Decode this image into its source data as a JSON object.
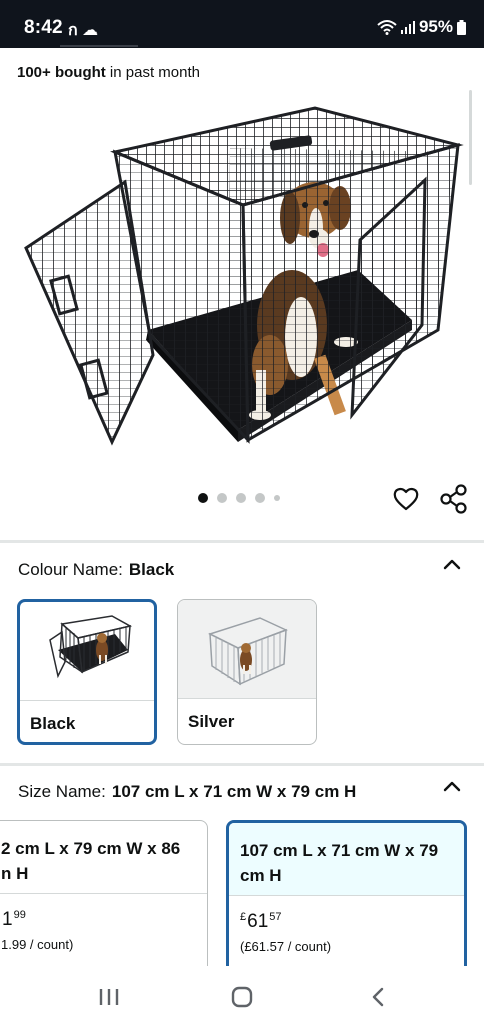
{
  "status_bar": {
    "time": "8:42",
    "app_icons": "ก ☁",
    "battery": "95%"
  },
  "product": {
    "bought_bold": "100+ bought",
    "bought_rest": " in past month",
    "image_icon": "dog-crate-photo",
    "image_count": 5,
    "selected_image": 1
  },
  "colour": {
    "label": "Colour Name:",
    "value": "Black",
    "options": [
      {
        "label": "Black",
        "selected": true
      },
      {
        "label": "Silver",
        "selected": false
      }
    ]
  },
  "size": {
    "label": "Size Name:",
    "value": "107 cm L x 71 cm W x 79 cm H",
    "options": [
      {
        "title": "2 cm L x 79 cm W x 86\nn H",
        "price_currency": "",
        "price_whole": "1",
        "price_fraction": "99",
        "per_count": "1.99 / count)",
        "selected": false
      },
      {
        "title": "107 cm L x 71 cm W x 79\ncm H",
        "price_currency": "£",
        "price_whole": "61",
        "price_fraction": "57",
        "per_count": "(£61.57 / count)",
        "selected": true
      }
    ]
  },
  "colors": {
    "accent": "#2162a1",
    "selected_bg": "#edfdff",
    "status_bar": "#0f141c"
  },
  "icons": [
    "wifi-icon",
    "signal-icon",
    "battery-icon",
    "heart-icon",
    "share-icon",
    "chevron-up-icon",
    "nav-recents-icon",
    "nav-home-icon",
    "nav-back-icon"
  ]
}
